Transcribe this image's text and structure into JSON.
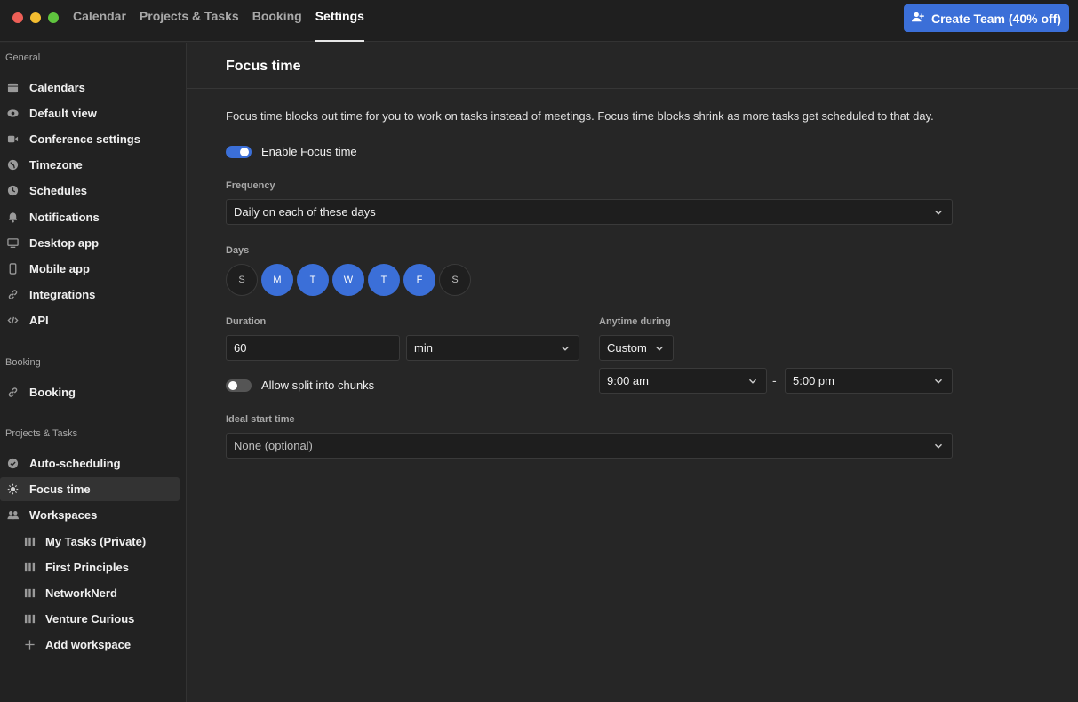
{
  "topnav": {
    "items": [
      {
        "label": "Calendar",
        "active": false
      },
      {
        "label": "Projects & Tasks",
        "active": false
      },
      {
        "label": "Booking",
        "active": false
      },
      {
        "label": "Settings",
        "active": true
      }
    ],
    "create_team_label": "Create Team (40% off)",
    "create_team_icon": "add-user-icon",
    "accent": "#3b6fd8"
  },
  "sidebar": {
    "sections": [
      {
        "title": "General"
      },
      {
        "title": "Booking"
      },
      {
        "title": "Projects & Tasks"
      }
    ],
    "general_items": [
      {
        "label": "Calendars",
        "icon": "calendar-icon"
      },
      {
        "label": "Default view",
        "icon": "eye-icon"
      },
      {
        "label": "Conference settings",
        "icon": "video-icon"
      },
      {
        "label": "Timezone",
        "icon": "globe-icon"
      },
      {
        "label": "Schedules",
        "icon": "clock-icon"
      },
      {
        "label": "Notifications",
        "icon": "bell-icon"
      },
      {
        "label": "Desktop app",
        "icon": "monitor-icon"
      },
      {
        "label": "Mobile app",
        "icon": "phone-icon"
      },
      {
        "label": "Integrations",
        "icon": "link-icon"
      },
      {
        "label": "API",
        "icon": "code-icon"
      }
    ],
    "booking_items": [
      {
        "label": "Booking",
        "icon": "link-icon"
      }
    ],
    "projects_items": [
      {
        "label": "Auto-scheduling",
        "icon": "check-circle-icon"
      },
      {
        "label": "Focus time",
        "icon": "lightbulb-icon",
        "active": true
      },
      {
        "label": "Workspaces",
        "icon": "users-icon"
      }
    ],
    "workspaces": [
      {
        "label": "My Tasks (Private)",
        "icon": "board-icon"
      },
      {
        "label": "First Principles",
        "icon": "board-icon"
      },
      {
        "label": "NetworkNerd",
        "icon": "board-icon"
      },
      {
        "label": "Venture Curious",
        "icon": "board-icon"
      },
      {
        "label": "Add workspace",
        "icon": "plus-icon"
      }
    ]
  },
  "main": {
    "title": "Focus time",
    "description": "Focus time blocks out time for you to work on tasks instead of meetings. Focus time blocks shrink as more tasks get scheduled to that day.",
    "enable_toggle": {
      "label": "Enable Focus time",
      "on": true
    },
    "frequency": {
      "label": "Frequency",
      "value": "Daily on each of these days"
    },
    "days": {
      "label": "Days",
      "items": [
        {
          "letter": "S",
          "selected": false
        },
        {
          "letter": "M",
          "selected": true
        },
        {
          "letter": "T",
          "selected": true
        },
        {
          "letter": "W",
          "selected": true
        },
        {
          "letter": "T",
          "selected": true
        },
        {
          "letter": "F",
          "selected": true
        },
        {
          "letter": "S",
          "selected": false
        }
      ]
    },
    "duration": {
      "label": "Duration",
      "value": "60",
      "unit": "min"
    },
    "split_toggle": {
      "label": "Allow split into chunks",
      "on": false
    },
    "anytime": {
      "label": "Anytime during",
      "mode": "Custom",
      "start": "9:00 am",
      "separator": "-",
      "end": "5:00 pm"
    },
    "ideal_start": {
      "label": "Ideal start time",
      "placeholder": "None (optional)"
    }
  }
}
